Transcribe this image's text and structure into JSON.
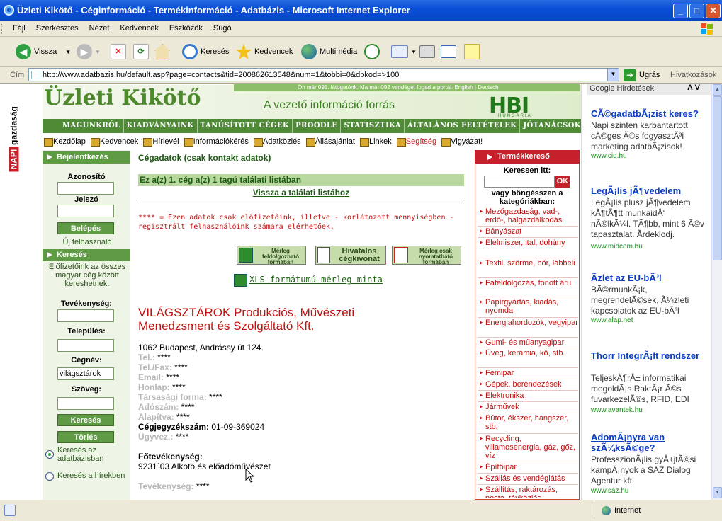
{
  "window": {
    "title": "Üzleti Kikötő - Céginformáció - Termékinformáció - Adatbázis - Microsoft Internet Explorer"
  },
  "menu": [
    "Fájl",
    "Szerkesztés",
    "Nézet",
    "Kedvencek",
    "Eszközök",
    "Súgó"
  ],
  "toolbar": {
    "back": "Vissza",
    "search": "Keresés",
    "favorites": "Kedvencek",
    "media": "Multimédia"
  },
  "address": {
    "label": "Cím",
    "url": "http://www.adatbazis.hu/default.asp?page=contacts&tid=200862613548&num=1&tobbi=0&dbkod=>100",
    "go": "Ugrás",
    "links": "Hivatkozások"
  },
  "status": {
    "zone": "Internet"
  },
  "site": {
    "side_label_a": "NAPI",
    "side_label_b": "gazdaság",
    "logo": "Üzleti Kikötő",
    "topstrip": "Ön már 091. látogatónk. Ma már 092 vendéget fogad a portál.   English | Deutsch",
    "slogan": "A vezető információ forrás",
    "hbi": "HBI",
    "hbi_sub": "HUNGÁRIA",
    "nav": [
      "MAGUNKRÓL",
      "KIADVÁNYAINK",
      "TANÚSÍTOTT CÉGEK",
      "PROODLE",
      "STATISZTIKA",
      "ÁLTALÁNOS FELTÉTELEK",
      "JÓTANÁCSOK"
    ],
    "subnav": [
      "Kezdőlap",
      "Kedvencek",
      "Hírlevél",
      "Információkérés",
      "Adatközlés",
      "Állásajánlat",
      "Linkek",
      "Segítség",
      "Vigyázat!"
    ]
  },
  "sidebar": {
    "login_head": "Bejelentkezés",
    "id_label": "Azonosító",
    "pw_label": "Jelszó",
    "login_btn": "Belépés",
    "new_user": "Új felhasználó",
    "search_head": "Keresés",
    "search_desc": "Előfizetőink az összes magyar cég között kereshetnek.",
    "activity_label": "Tevékenység:",
    "town_label": "Település:",
    "name_label": "Cégnév:",
    "name_value": "világsztárok",
    "text_label": "Szöveg:",
    "search_btn": "Keresés",
    "clear_btn": "Törlés",
    "radio_db": "Keresés az adatbázisban",
    "radio_news": "Keresés a hírekben"
  },
  "main": {
    "title": "Cégadatok (csak kontakt adatok)",
    "result": "Ez a(z) 1. cég a(z) 1 tagú találati listában",
    "back": "Vissza a találati listához",
    "note": "**** = Ezen adatok csak előfizetőink, illetve - korlátozott mennyiségben - regisztrált felhasználóink számára elérhetőek.",
    "btn_balance": "Mérleg feldolgozható formában",
    "btn_extract_a": "Hivatalos",
    "btn_extract_b": "cégkivonat",
    "btn_print": "Mérleg csak nyomtatható formában",
    "xls": "XLS formátumú mérleg minta",
    "company": "VILÁGSZTÁROK Produkciós, Művészeti Menedzsment és Szolgáltató Kft.",
    "address": "1062 Budapest, Andrássy út 124.",
    "fields": [
      {
        "k": "Tel.:",
        "v": " ****"
      },
      {
        "k": "Tel./Fax:",
        "v": " ****"
      },
      {
        "k": "Email:",
        "v": " ****"
      },
      {
        "k": "Honlap:",
        "v": " ****"
      },
      {
        "k": "Társasági forma:",
        "v": " ****"
      },
      {
        "k": "Adószám:",
        "v": " ****"
      },
      {
        "k": "Alapítva:",
        "v": " ****"
      }
    ],
    "regno_k": "Cégjegyzékszám:",
    "regno_v": " 01-09-369024",
    "exec_k": "Ügyvez.:",
    "exec_v": " ****",
    "main_act_k": "Főtevékenység:",
    "main_act_v": " 9231´03 Alkotó és előadóművészet",
    "act_k": "Tevékenység:",
    "act_v": " ****"
  },
  "products": {
    "head": "Termékkereső",
    "search": "Keressen itt:",
    "ok": "OK",
    "browse": "vagy böngésszen a kategóriákban:",
    "cats": [
      "Mezőgazdaság, vad-, erdő-, halgazdálkodás",
      "Bányászat",
      "Élelmiszer, ital, dohány",
      "Textil, szőrme, bőr, lábbeli",
      "Fafeldolgozás, fonott áru",
      "Papírgyártás, kiadás, nyomda",
      "Energiahordozók, vegyipar",
      "Gumi- és műanyagipar",
      "Üveg, kerámia, kő, stb.",
      "Fémipar",
      "Gépek, berendezések",
      "Elektronika",
      "Járművek",
      "Bútor, ékszer, hangszer, stb.",
      "Recycling, villamosenergia, gáz, gőz, víz",
      "Építőipar",
      "Szállás és vendéglátás",
      "Szállítás, raktározás, posta, távközlés"
    ]
  },
  "ads": {
    "header": "Google Hirdetések",
    "nav": "Λ V",
    "items": [
      {
        "t": "CÃ©gadatbÃ¡zist keres?",
        "d": "Napi szinten karbantartott cÃ©ges Ã©s fogyasztÃ³i marketing adatbÃ¡zisok!",
        "u": "www.cid.hu"
      },
      {
        "t": "LegÃ¡lis jÃ¶vedelem",
        "d": "LegÃ¡lis plusz jÃ¶vedelem kÃ¶tÃ¶tt munkaidÅ‘ nÃ©lkÃ¼l. TÃ¶bb, mint 6 Ã©v tapasztalat. Ãrdeklodj.",
        "u": "www.midcom.hu"
      },
      {
        "t": "Ãzlet az EU-bÃ³l",
        "d": "BÃ©rmunkÃ¡k, megrendelÃ©sek, Ã¼zleti kapcsolatok az EU-bÃ³l",
        "u": "www.alap.net"
      },
      {
        "t": "Thorr IntegrÃ¡lt rendszer",
        "d": "TeljeskÃ¶rÅ± informatikai megoldÃ¡s RaktÃ¡r Ã©s fuvarkezelÃ©s, RFID, EDI",
        "u": "www.avantek.hu"
      },
      {
        "t": "AdomÃ¡nyra van szÃ¼ksÃ©ge?",
        "d": "ProfesszionÃ¡lis gyÅ±jtÃ©si kampÃ¡nyok a SAZ Dialog Agentur kft",
        "u": "www.saz.hu"
      }
    ]
  }
}
